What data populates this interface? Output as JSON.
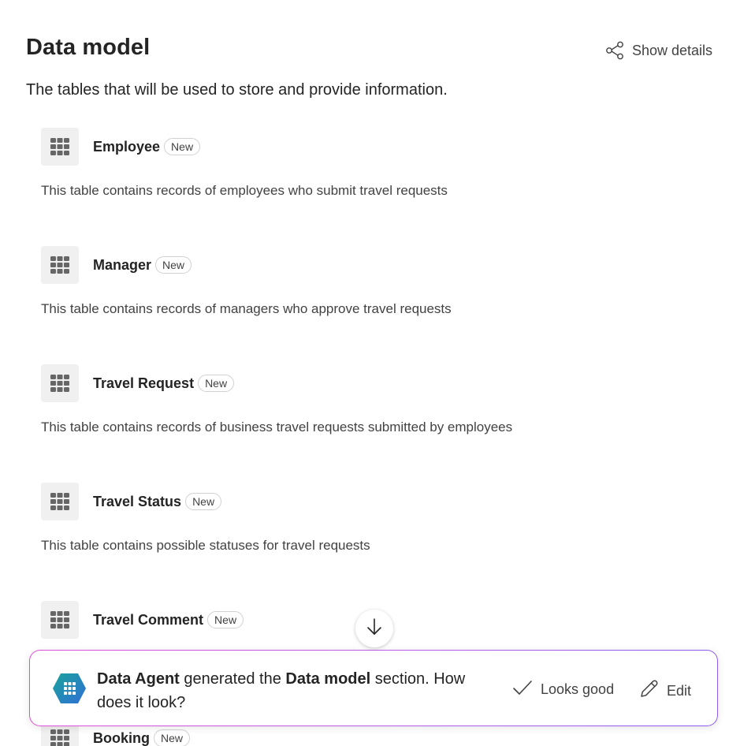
{
  "header": {
    "title": "Data model",
    "show_details_label": "Show details",
    "subtitle": "The tables that will be used to store and provide information."
  },
  "tables": [
    {
      "name": "Employee",
      "badge": "New",
      "description": "This table contains records of employees who submit travel requests"
    },
    {
      "name": "Manager",
      "badge": "New",
      "description": "This table contains records of managers who approve travel requests"
    },
    {
      "name": "Travel Request",
      "badge": "New",
      "description": "This table contains records of business travel requests submitted by employees"
    },
    {
      "name": "Travel Status",
      "badge": "New",
      "description": "This table contains possible statuses for travel requests"
    },
    {
      "name": "Travel Comment",
      "badge": "New",
      "description": ""
    },
    {
      "name": "Booking",
      "badge": "New",
      "description": ""
    }
  ],
  "agent_bar": {
    "agent_name": "Data Agent",
    "text_middle": " generated the ",
    "section_name": "Data model",
    "text_end": " section. How does it look?",
    "looks_good_label": "Looks good",
    "edit_label": "Edit"
  },
  "icons": {
    "show_details": "relationship-nodes-icon",
    "table": "table-grid-icon",
    "scroll": "arrow-down-icon",
    "agent": "hexagon-table-icon",
    "looks_good": "checkmark-icon",
    "edit": "pencil-icon"
  },
  "colors": {
    "accent_gradient_start": "#e04fd8",
    "accent_gradient_end": "#8a5cf0",
    "logo_teal": "#1aa39a",
    "logo_blue": "#2f6fd6",
    "tile_background": "#f0f0f0"
  }
}
